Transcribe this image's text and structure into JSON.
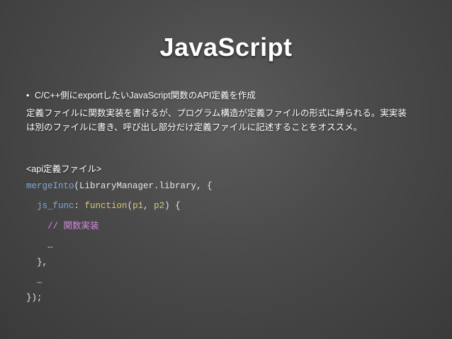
{
  "slide": {
    "title": "JavaScript",
    "bullet": "C/C++側にexportしたいJavaScript関数のAPI定義を作成",
    "paragraph_line1": "定義ファイルに関数実装を書けるが、プログラム構造が定義ファイルの形式に縛られる。実実装",
    "paragraph_line2": "は別のファイルに書き、呼び出し部分だけ定義ファイルに記述することをオススメ。",
    "subheading": "<api定義ファイル>"
  },
  "code": {
    "l1_fn": "mergeInto",
    "l1_rest": "(LibraryManager.library, {",
    "l2_indent": "  ",
    "l2_name": "js_func",
    "l2_colon": ": ",
    "l2_kw": "function",
    "l2_open": "(",
    "l2_p1": "p1",
    "l2_comma": ", ",
    "l2_p2": "p2",
    "l2_close": ") {",
    "l3_indent": "    ",
    "l3_comment": "// 関数実装",
    "l4": "    …",
    "l5": "  },",
    "l6": "  …",
    "l7": "});"
  },
  "colors": {
    "background": "#4a4a4a",
    "function_name": "#7fa7d6",
    "keyword": "#d9c878",
    "comment": "#d28ae0",
    "text": "#ffffff"
  }
}
